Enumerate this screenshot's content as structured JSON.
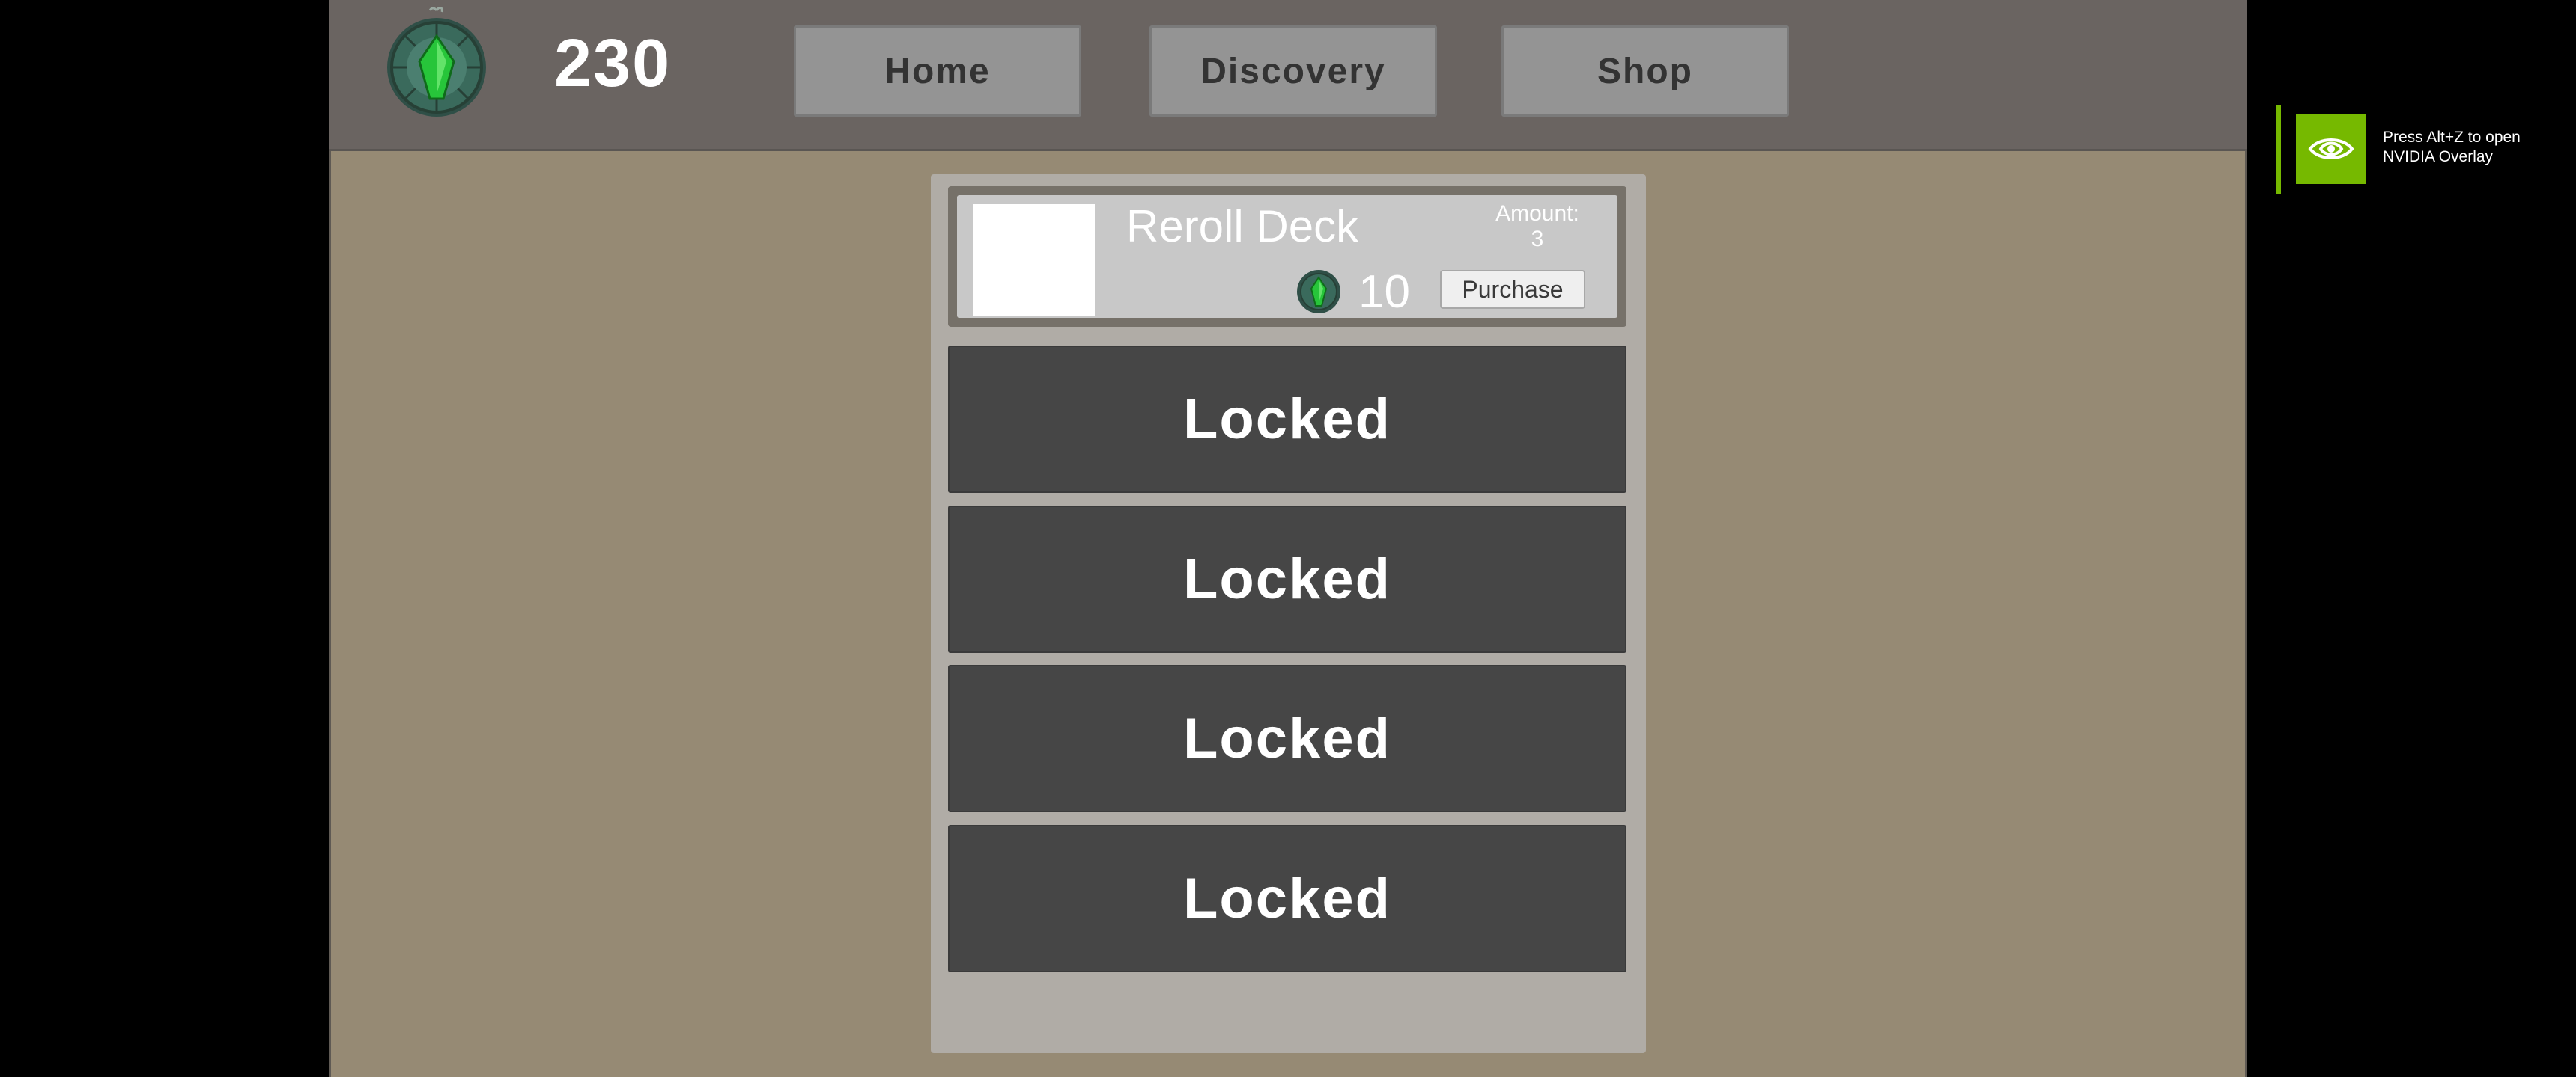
{
  "header": {
    "currency_amount": "230",
    "currency_icon": "green-gem-medallion-icon",
    "nav": {
      "home_label": "Home",
      "discovery_label": "Discovery",
      "shop_label": "Shop"
    }
  },
  "shop": {
    "item": {
      "title": "Reroll Deck",
      "amount_label": "Amount:",
      "amount_value": "3",
      "price": "10",
      "price_icon": "green-gem-medallion-icon",
      "purchase_label": "Purchase"
    },
    "slots": [
      {
        "label": "Locked"
      },
      {
        "label": "Locked"
      },
      {
        "label": "Locked"
      },
      {
        "label": "Locked"
      }
    ]
  },
  "overlay": {
    "line1": "Press Alt+Z to open",
    "line2": "NVIDIA Overlay",
    "icon": "nvidia-eye-icon"
  },
  "colors": {
    "game_background": "#968a74",
    "topbar": "#6a6461",
    "gem_green": "#2ecc40",
    "locked_slot": "#464646",
    "nvidia_green": "#76b900"
  }
}
